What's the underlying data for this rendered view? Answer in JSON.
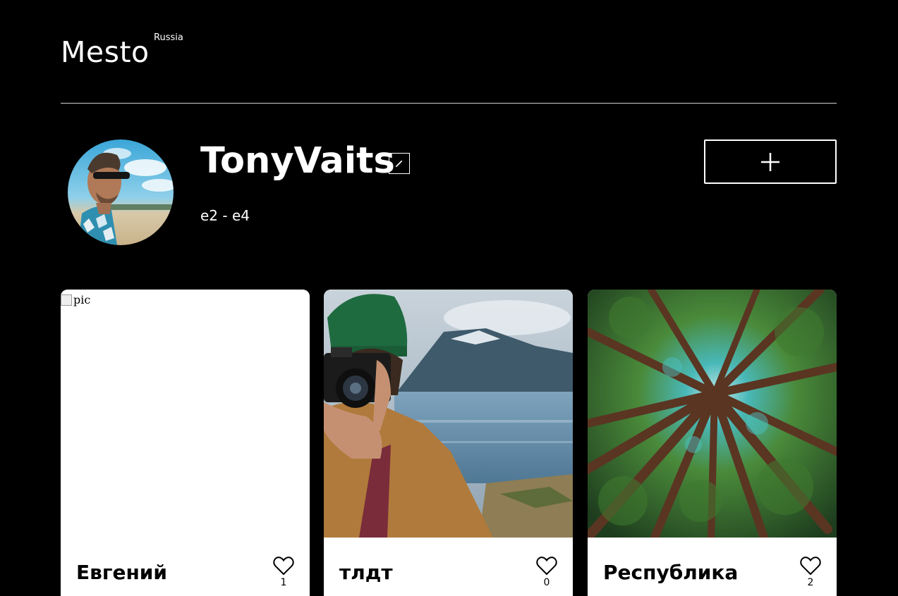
{
  "header": {
    "logo": "Mesto",
    "logo_sup": "Russia"
  },
  "profile": {
    "name": "TonyVaits",
    "about": "e2 - e4",
    "avatar_alt": "avatar photo",
    "edit_icon": "pencil-icon",
    "add_icon": "plus-icon"
  },
  "cards": [
    {
      "title": "Евгений",
      "likes": "1",
      "image_alt": "pic",
      "image_state": "broken"
    },
    {
      "title": "тлдт",
      "likes": "0",
      "image": "photographer with camera by the lake"
    },
    {
      "title": "Республика",
      "likes": "2",
      "image": "forest canopy looking up"
    }
  ],
  "colors": {
    "background": "#000000",
    "text": "#ffffff",
    "card_bg": "#ffffff",
    "card_text": "#000000"
  }
}
